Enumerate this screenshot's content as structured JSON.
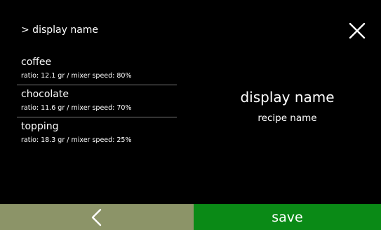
{
  "header": {
    "breadcrumb": "> display name",
    "close_icon": "close-icon"
  },
  "ingredients": [
    {
      "name": "coffee",
      "detail": "ratio: 12.1 gr / mixer speed: 80%"
    },
    {
      "name": "chocolate",
      "detail": "ratio: 11.6 gr / mixer speed: 70%"
    },
    {
      "name": "topping",
      "detail": "ratio: 18.3 gr / mixer speed: 25%"
    }
  ],
  "panel": {
    "title": "display name",
    "subtitle": "recipe name"
  },
  "footer": {
    "back_icon": "chevron-left-icon",
    "save_label": "save"
  },
  "colors": {
    "background": "#000000",
    "text": "#ffffff",
    "divider": "#7a7a7a",
    "back_button": "#8c9468",
    "save_button": "#0a8a16"
  }
}
